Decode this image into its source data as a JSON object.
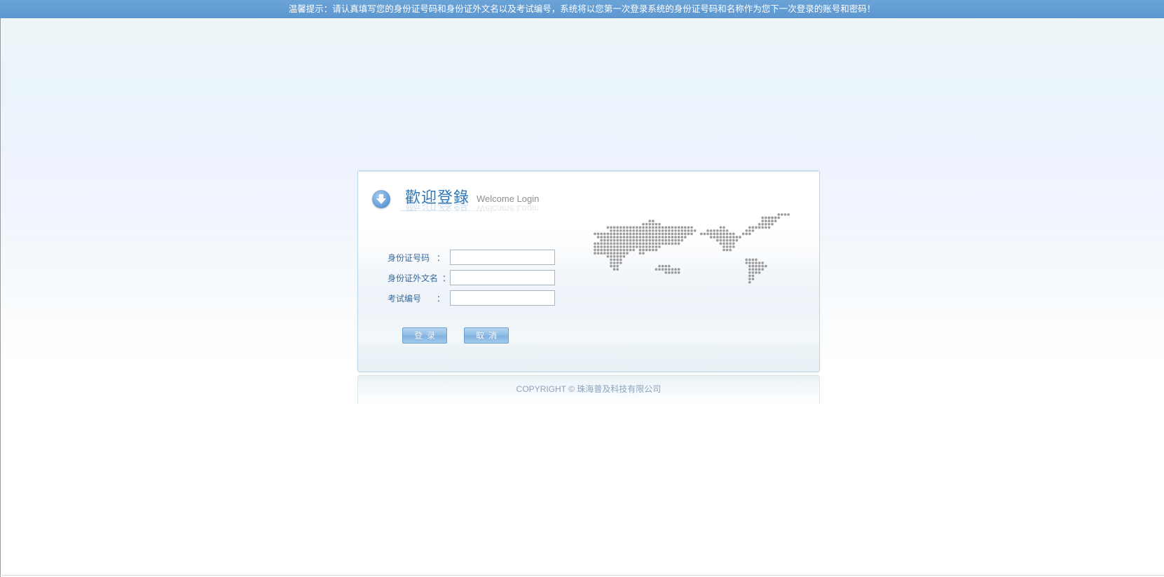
{
  "notice": {
    "text": "温馨提示：请认真填写您的身份证号码和身份证外文名以及考试编号，系统将以您第一次登录系统的身份证号码和名称作为您下一次登录的账号和密码！"
  },
  "login": {
    "title_cn": "歡迎登錄",
    "title_en": "Welcome Login",
    "fields": [
      {
        "label": "身份证号码",
        "colon": "：",
        "value": ""
      },
      {
        "label": "身份证外文名",
        "colon": "：",
        "value": ""
      },
      {
        "label": "考试编号",
        "colon": "：",
        "value": ""
      }
    ],
    "login_button": "登录",
    "cancel_button": "取消"
  },
  "footer": {
    "copyright": "COPYRIGHT © 珠海普及科技有限公司"
  },
  "colors": {
    "notice_bar": "#5d97cf",
    "title": "#2f77b8",
    "label": "#3a6a9a",
    "button": "#8cbbe5",
    "map_dots": "#9a9a9a"
  },
  "icons": {
    "title_icon": "arrow-down-circle-icon",
    "map": "dotted-world-map"
  }
}
